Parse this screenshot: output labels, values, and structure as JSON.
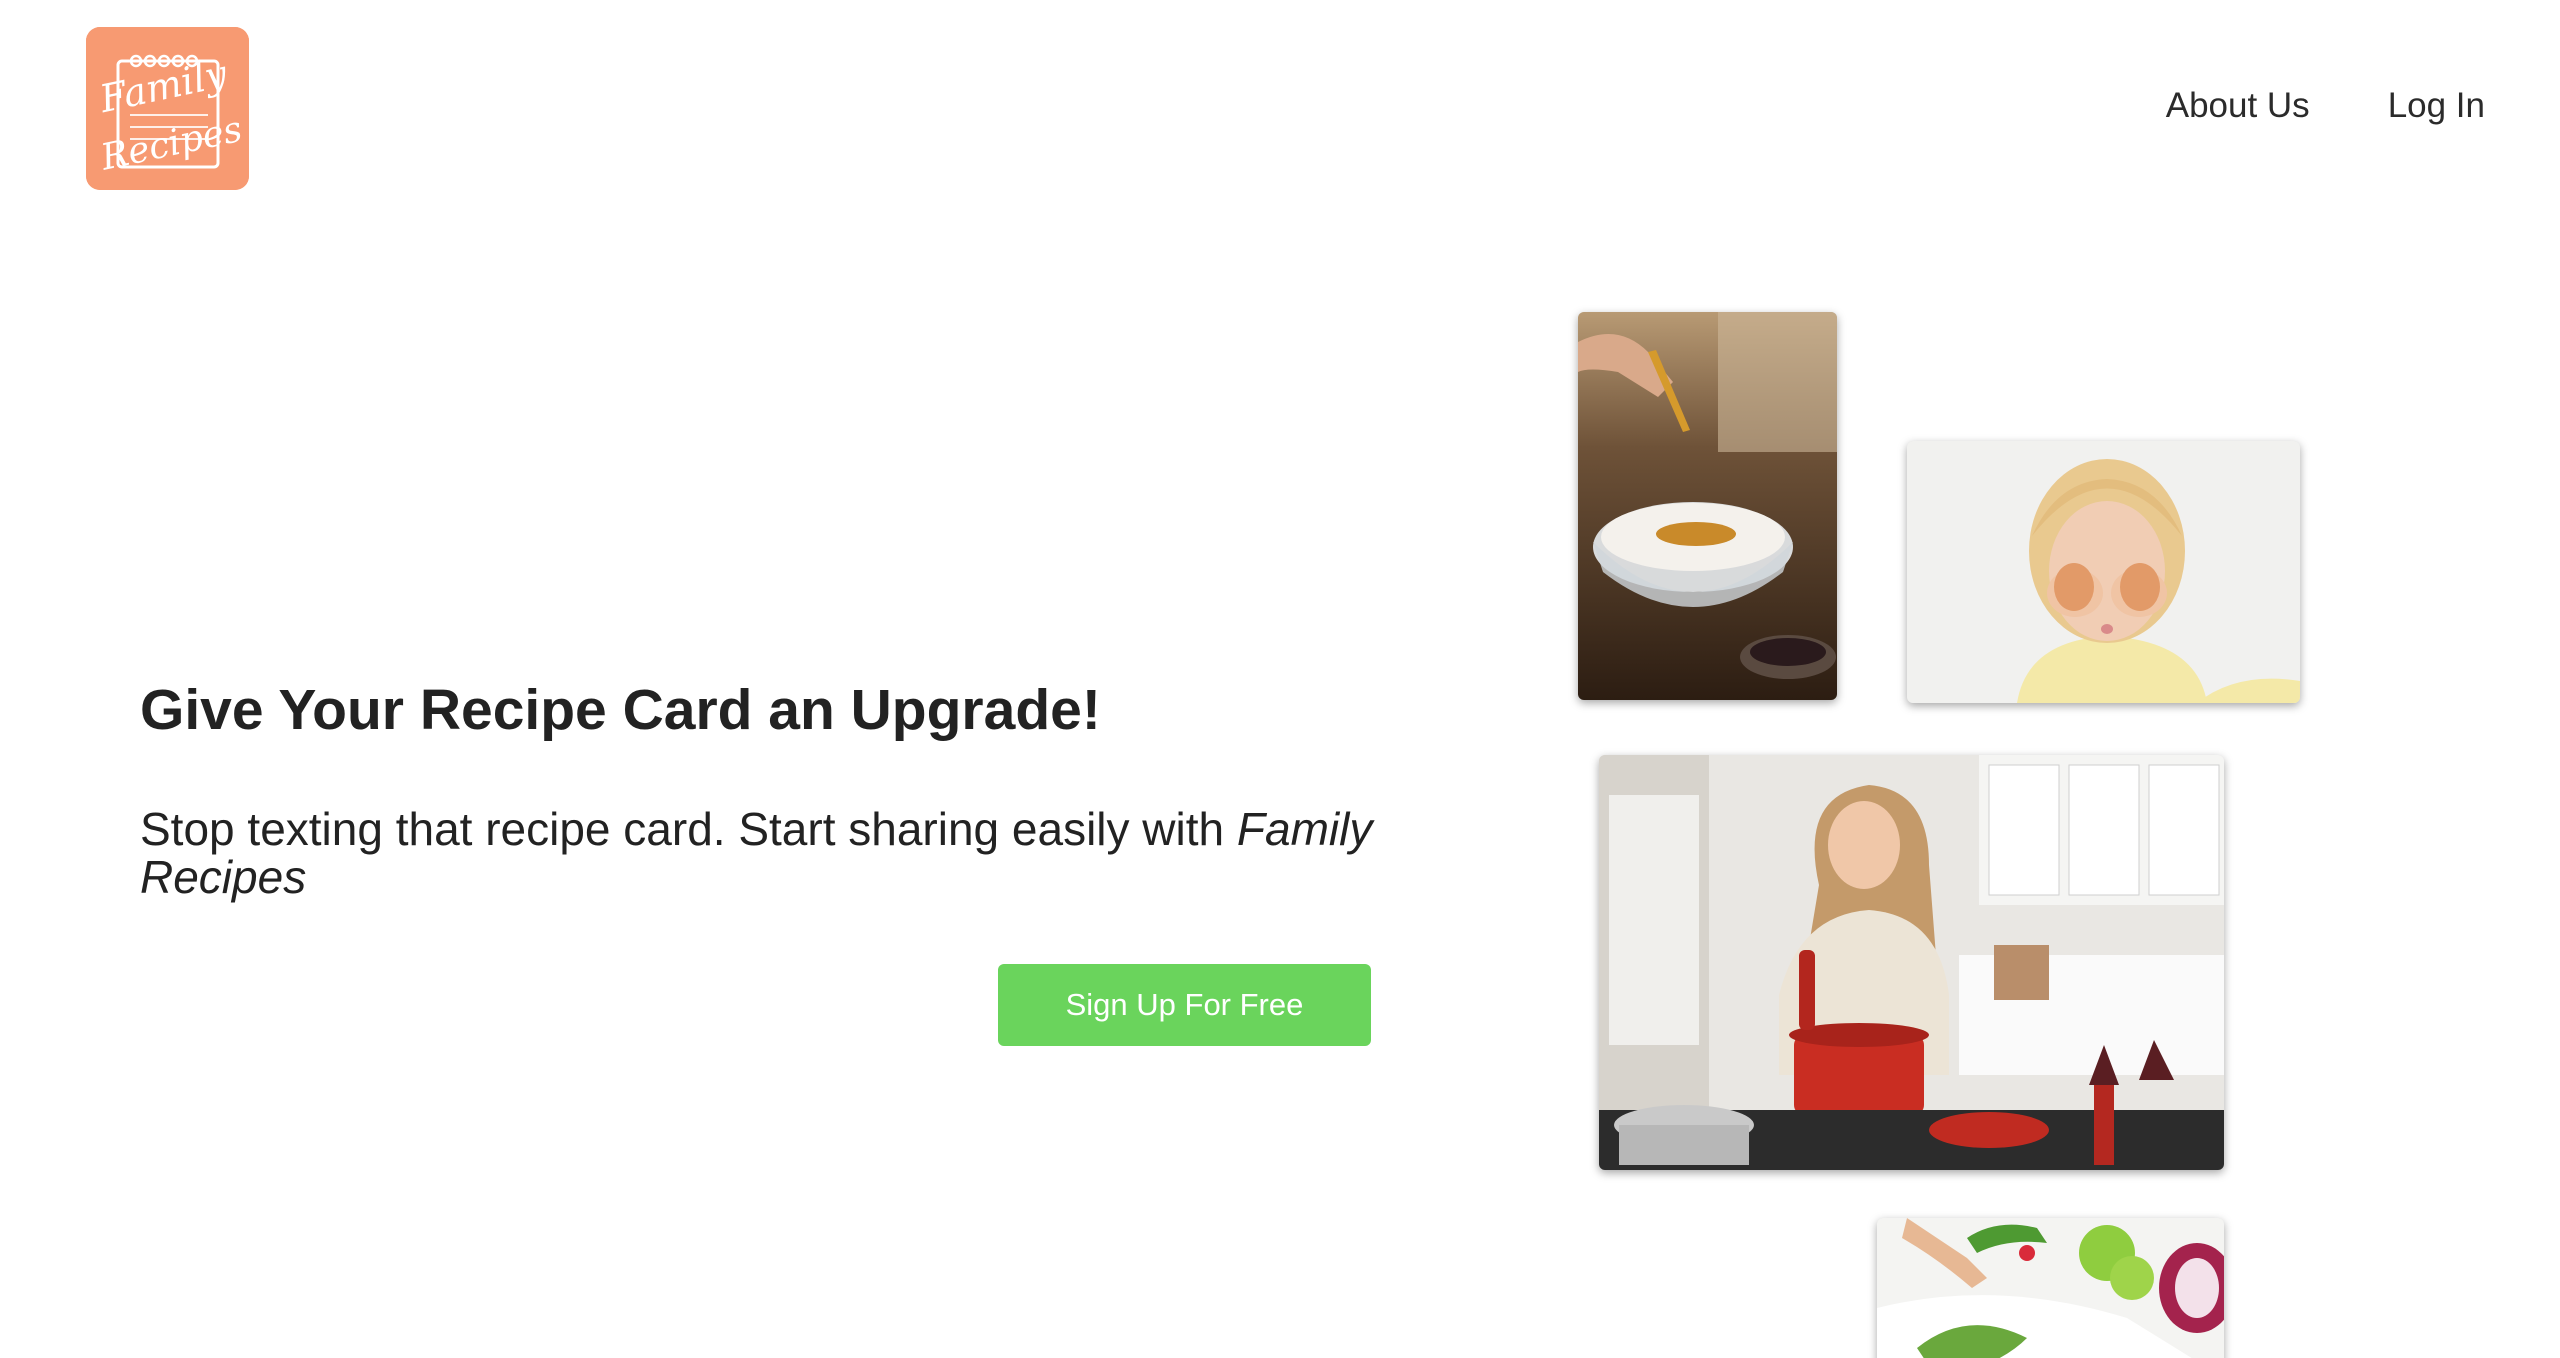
{
  "brand": {
    "logo_text_line1": "Family",
    "logo_text_line2": "Recipes",
    "color": "#f79a72"
  },
  "nav": {
    "items": [
      {
        "label": "About Us"
      },
      {
        "label": "Log In"
      }
    ]
  },
  "hero": {
    "title": "Give Your Recipe Card an Upgrade!",
    "subtitle_prefix": "Stop texting that recipe card. Start sharing easily with ",
    "subtitle_brand": "Family Recipes",
    "cta_label": "Sign Up For Free",
    "cta_color": "#6ad45c"
  },
  "gallery": {
    "images": [
      {
        "name": "spice-pouring-photo"
      },
      {
        "name": "girl-with-eggs-photo"
      },
      {
        "name": "woman-cooking-photo"
      },
      {
        "name": "salad-prep-photo"
      }
    ]
  }
}
